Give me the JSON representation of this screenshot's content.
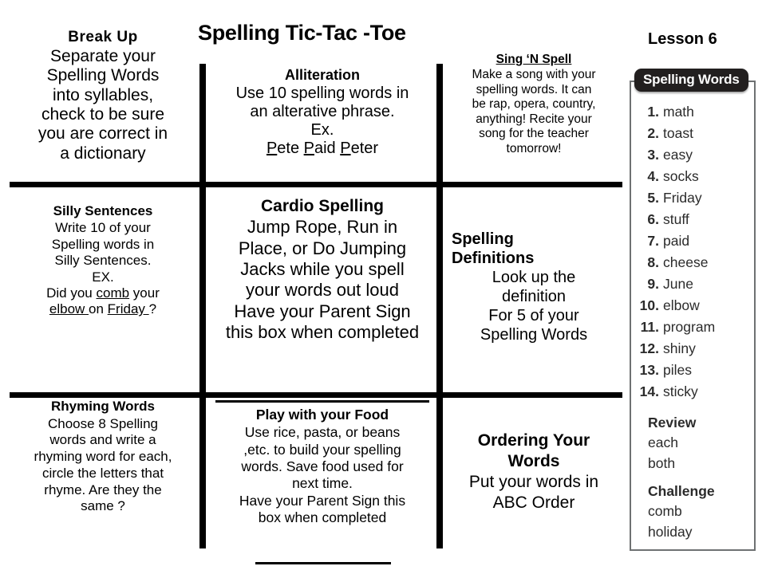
{
  "header": {
    "title": "Spelling Tic-Tac -Toe",
    "lesson": "Lesson 6"
  },
  "grid": {
    "cells": [
      {
        "id": "break-up",
        "heading": "Break  Up",
        "body": "Separate your Spelling Words into syllables, check to be sure you are correct in a dictionary",
        "lines": [
          "Separate your",
          "Spelling Words",
          "into syllables,",
          "check to be sure",
          "you are correct in",
          "a dictionary"
        ]
      },
      {
        "id": "alliteration",
        "heading": "Alliteration",
        "body": "Use 10 spelling words in an alterative phrase. Ex. Pete Paid Peter",
        "lines": [
          "Use 10 spelling words in",
          "an alterative phrase.",
          "Ex."
        ],
        "example": "Pete Paid Peter"
      },
      {
        "id": "sing-n-spell",
        "heading": "Sing ‘N Spell",
        "body": "Make a song with your spelling words.  It can be rap, opera, country, anything!  Recite your song for the teacher tomorrow!",
        "lines": [
          "Make a song with your",
          "spelling words.  It can",
          "be rap, opera, country,",
          "anything!  Recite your",
          "song for the teacher",
          "tomorrow!"
        ]
      },
      {
        "id": "silly-sentences",
        "heading": "Silly Sentences",
        "body": "Write 10 of your Spelling words in Silly Sentences. EX. Did you comb your elbow  on Friday ?",
        "lines": [
          "Write 10 of your",
          "Spelling words in",
          "Silly Sentences.",
          "EX."
        ],
        "example_prefix": "Did you ",
        "example_word1": "comb",
        "example_mid": " your",
        "example_word2": "elbow ",
        "example_mid2": " on ",
        "example_word3": "Friday ",
        "example_suffix": "?"
      },
      {
        "id": "cardio-spelling",
        "heading": "Cardio Spelling",
        "body": "Jump Rope, Run in Place, or Do Jumping Jacks while you spell your words out loud Have your Parent Sign this box when completed",
        "lines": [
          "Jump Rope, Run in",
          "Place, or Do Jumping",
          "Jacks while you spell",
          "your words out loud",
          "Have your Parent Sign",
          "this box when completed"
        ]
      },
      {
        "id": "spelling-definitions",
        "heading": "Spelling Definitions",
        "heading_lines": [
          "Spelling",
          "Definitions"
        ],
        "body": "Look up the definition For 5 of your Spelling Words",
        "lines": [
          "Look up the",
          "definition",
          "For 5 of your",
          "Spelling Words"
        ]
      },
      {
        "id": "rhyming-words",
        "heading": "Rhyming Words",
        "body": "Choose 8 Spelling words and write a rhyming word for each, circle the letters that rhyme. Are they the same ?",
        "lines": [
          "Choose 8 Spelling",
          "words and write a",
          "rhyming word for each,",
          "circle the letters that",
          "rhyme. Are they the",
          "same ?"
        ]
      },
      {
        "id": "play-with-your-food",
        "heading": "Play with your Food",
        "body": "Use rice, pasta, or  beans ,etc. to build your spelling words.  Save food used for next time. Have your Parent Sign this box when completed",
        "lines": [
          "Use rice, pasta, or  beans",
          ",etc. to build your spelling",
          "words.  Save food used for",
          "next time.",
          "Have your Parent Sign this",
          "box when completed"
        ]
      },
      {
        "id": "ordering-your-words",
        "heading": "Ordering Your Words",
        "heading_lines": [
          "Ordering Your",
          "Words"
        ],
        "body": "Put your words in ABC Order",
        "lines": [
          "Put your words in",
          "ABC Order"
        ]
      }
    ]
  },
  "words_panel": {
    "badge": "Spelling Words",
    "items": [
      {
        "num": "1.",
        "word": "math"
      },
      {
        "num": "2.",
        "word": "toast"
      },
      {
        "num": "3.",
        "word": "easy"
      },
      {
        "num": "4.",
        "word": "socks"
      },
      {
        "num": "5.",
        "word": "Friday"
      },
      {
        "num": "6.",
        "word": "stuff"
      },
      {
        "num": "7.",
        "word": "paid"
      },
      {
        "num": "8.",
        "word": "cheese"
      },
      {
        "num": "9.",
        "word": "June"
      },
      {
        "num": "10.",
        "word": "elbow"
      },
      {
        "num": "11.",
        "word": "program"
      },
      {
        "num": "12.",
        "word": "shiny"
      },
      {
        "num": "13.",
        "word": "piles"
      },
      {
        "num": "14.",
        "word": "sticky"
      }
    ],
    "review": {
      "label": "Review",
      "words": [
        "each",
        "both"
      ]
    },
    "challenge": {
      "label": "Challenge",
      "words": [
        "comb",
        "holiday"
      ]
    }
  },
  "colors": {
    "rule": "#000000",
    "badge_bg": "#221f1f",
    "panel_border": "#6e7172",
    "text": "#000000"
  }
}
